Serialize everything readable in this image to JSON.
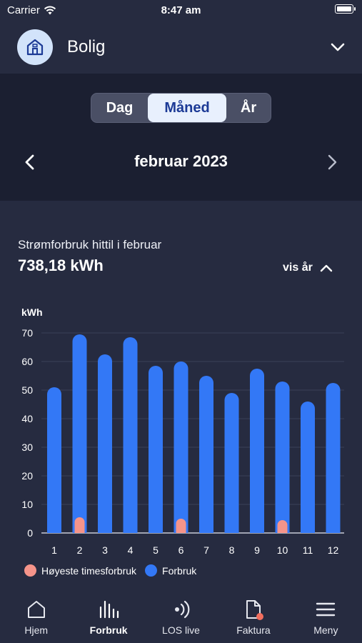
{
  "status_bar": {
    "carrier": "Carrier",
    "time": "8:47 am"
  },
  "header": {
    "title": "Bolig"
  },
  "period_selector": {
    "segments": [
      "Dag",
      "Måned",
      "År"
    ],
    "selected": "Måned",
    "period_label": "februar 2023"
  },
  "summary": {
    "label": "Strømforbruk hittil i februar",
    "value": "738,18 kWh",
    "toggle_label": "vis år"
  },
  "chart_data": {
    "type": "bar",
    "ylabel": "kWh",
    "ylim": [
      0,
      70
    ],
    "yticks": [
      0,
      10,
      20,
      30,
      40,
      50,
      60,
      70
    ],
    "categories": [
      "1",
      "2",
      "3",
      "4",
      "5",
      "6",
      "7",
      "8",
      "9",
      "10",
      "11",
      "12"
    ],
    "series": [
      {
        "name": "Forbruk",
        "color": "#3378f6",
        "values": [
          51,
          69.5,
          62.5,
          68.5,
          58.5,
          60,
          55,
          49,
          57.5,
          53,
          46,
          52.5
        ]
      },
      {
        "name": "Høyeste timesforbruk",
        "color": "#f5948a",
        "values": [
          null,
          5.5,
          null,
          null,
          null,
          5,
          null,
          null,
          null,
          4.5,
          null,
          null
        ]
      }
    ],
    "grid": true
  },
  "legend": [
    {
      "label": "Høyeste timesforbruk",
      "color": "#f5948a"
    },
    {
      "label": "Forbruk",
      "color": "#3378f6"
    }
  ],
  "tabbar": [
    {
      "label": "Hjem",
      "icon": "home-icon"
    },
    {
      "label": "Forbruk",
      "icon": "bars-icon",
      "active": true
    },
    {
      "label": "LOS live",
      "icon": "signal-icon"
    },
    {
      "label": "Faktura",
      "icon": "document-icon"
    },
    {
      "label": "Meny",
      "icon": "menu-icon"
    }
  ]
}
